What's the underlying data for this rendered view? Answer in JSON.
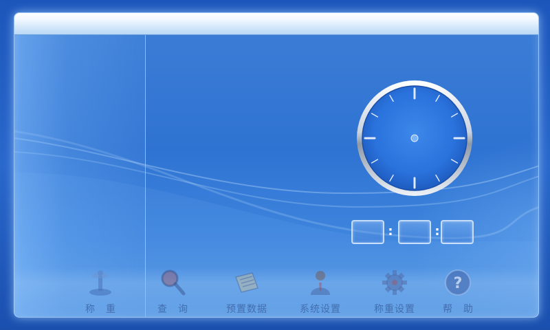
{
  "clock": {
    "hour_ticks": 12
  },
  "time": {
    "hours": "",
    "minutes": "",
    "seconds": "",
    "separator": ":"
  },
  "toolbar": {
    "items": [
      {
        "label": "称重",
        "icon": "scale-icon"
      },
      {
        "label": "查询",
        "icon": "magnifier-icon"
      },
      {
        "label": "预置数据",
        "icon": "notebook-icon"
      },
      {
        "label": "系统设置",
        "icon": "person-icon"
      },
      {
        "label": "称重设置",
        "icon": "gear-icon"
      },
      {
        "label": "帮助",
        "icon": "help-icon"
      }
    ]
  },
  "colors": {
    "background": "#1d56bb",
    "panel": "#3579d4",
    "clock_face": "#2f78e0",
    "clock_rim": "#e8edf5"
  }
}
